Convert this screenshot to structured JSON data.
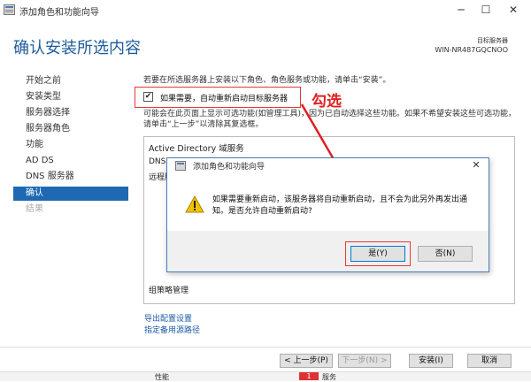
{
  "window": {
    "title": "添加角色和功能向导",
    "minimize": "─",
    "maximize": "☐",
    "close": "✕"
  },
  "header": {
    "page_title": "确认安装所选内容",
    "server_label": "目标服务器",
    "server_name": "WIN-NR487GQCNOO"
  },
  "nav": {
    "items": [
      {
        "label": "开始之前",
        "state": "normal"
      },
      {
        "label": "安装类型",
        "state": "normal"
      },
      {
        "label": "服务器选择",
        "state": "normal"
      },
      {
        "label": "服务器角色",
        "state": "normal"
      },
      {
        "label": "功能",
        "state": "normal"
      },
      {
        "label": "AD DS",
        "state": "normal"
      },
      {
        "label": "DNS 服务器",
        "state": "normal"
      },
      {
        "label": "确认",
        "state": "active"
      },
      {
        "label": "结果",
        "state": "disabled"
      }
    ]
  },
  "main": {
    "intro": "若要在所选服务器上安装以下角色、角色服务或功能，请单击“安装”。",
    "restart_checkbox": {
      "label": "如果需要，自动重新启动目标服务器",
      "checked": true,
      "mark": "✔"
    },
    "annotation": "勾选",
    "description": "可能会在此页面上显示可选功能(如管理工具)，因为已自动选择这些功能。如果不希望安装这些可选功能，请单击“上一步”以清除其复选框。",
    "list_items": [
      "Active Directory 域服务",
      "DNS",
      "远程服",
      "组策略管理"
    ],
    "export_link": "导出配置设置",
    "alt_source_link": "指定备用源路径"
  },
  "footer": {
    "prev": "< 上一步(P)",
    "next": "下一步(N) >",
    "install": "安装(I)",
    "cancel": "取消"
  },
  "bottom_strip": {
    "left_text": "性能",
    "badge": "1",
    "right_text": "服务"
  },
  "dialog": {
    "title": "添加角色和功能向导",
    "close": "✕",
    "message": "如果需要重新启动，该服务器将自动重新启动，且不会为此另外再发出通知。是否允许自动重新启动?",
    "yes": "是(Y)",
    "no": "否(N)"
  },
  "colors": {
    "accent": "#1f69b3",
    "title_blue": "#1d5d9c",
    "highlight_red": "#e53935",
    "link_blue": "#1a5aa6",
    "warning_yellow": "#f2c200"
  }
}
